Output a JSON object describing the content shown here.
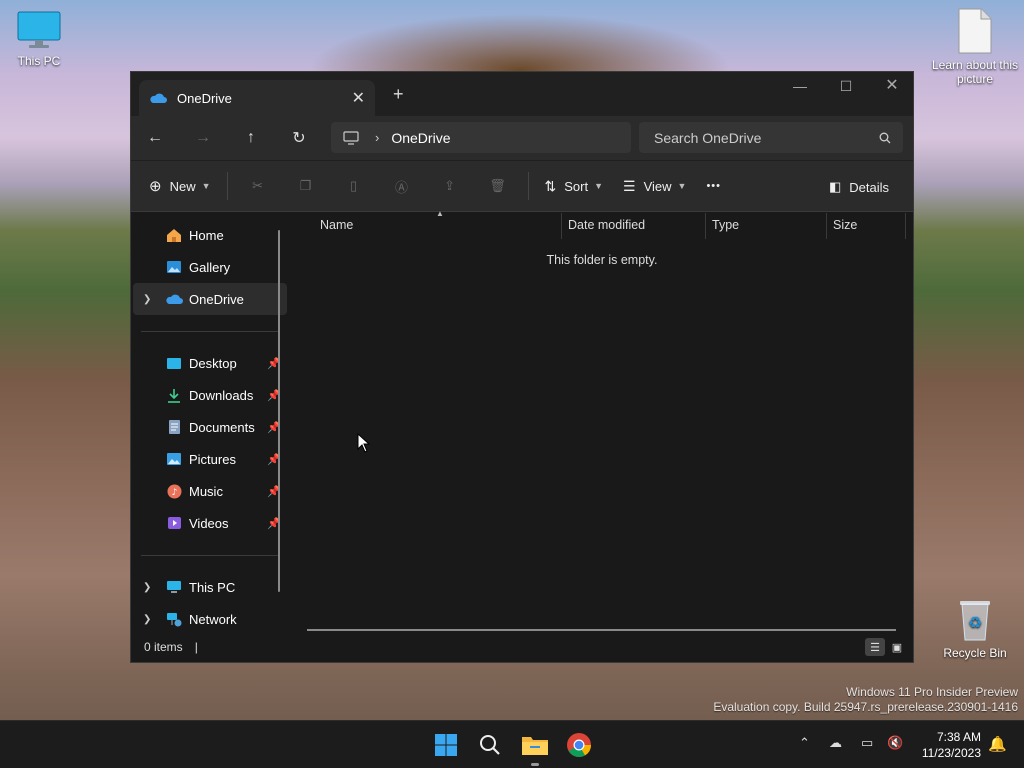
{
  "desktop": {
    "icons": [
      {
        "label": "This PC"
      },
      {
        "label": "Learn about this picture"
      },
      {
        "label": "Recycle Bin"
      }
    ],
    "watermark_line1": "Windows 11 Pro Insider Preview",
    "watermark_line2": "Evaluation copy. Build 25947.rs_prerelease.230901-1416"
  },
  "window": {
    "tab_title": "OneDrive",
    "new_tab_symbol": "+",
    "address_path": "OneDrive",
    "search_placeholder": "Search OneDrive",
    "commands": {
      "new_label": "New",
      "sort_label": "Sort",
      "view_label": "View",
      "more_symbol": "•••",
      "details_label": "Details"
    },
    "nav": {
      "quick": [
        {
          "label": "Home",
          "icon": "home-icon"
        },
        {
          "label": "Gallery",
          "icon": "gallery-icon"
        },
        {
          "label": "OneDrive",
          "icon": "onedrive-icon",
          "selected": true
        }
      ],
      "pinned": [
        {
          "label": "Desktop",
          "icon": "desktop-folder-icon"
        },
        {
          "label": "Downloads",
          "icon": "downloads-icon"
        },
        {
          "label": "Documents",
          "icon": "documents-icon"
        },
        {
          "label": "Pictures",
          "icon": "pictures-icon"
        },
        {
          "label": "Music",
          "icon": "music-icon"
        },
        {
          "label": "Videos",
          "icon": "videos-icon"
        }
      ],
      "devices": [
        {
          "label": "This PC",
          "icon": "this-pc-icon"
        },
        {
          "label": "Network",
          "icon": "network-icon"
        }
      ]
    },
    "columns": [
      "Name",
      "Date modified",
      "Type",
      "Size"
    ],
    "empty_message": "This folder is empty.",
    "status_items": "0 items",
    "status_caret": "|"
  },
  "taskbar": {
    "time": "7:38 AM",
    "date": "11/23/2023"
  },
  "colors": {
    "window_bg": "#191919",
    "toolbar_bg": "#2b2b2b",
    "accent": "#0078d4",
    "taskbar_bg": "#1c1c1c"
  }
}
